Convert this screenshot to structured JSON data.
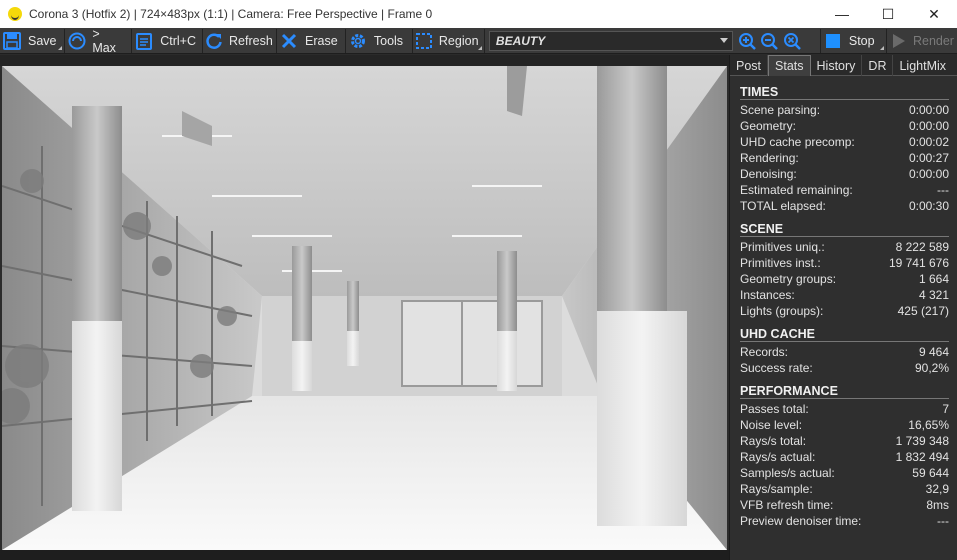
{
  "window": {
    "title": "Corona 3 (Hotfix 2) | 724×483px (1:1) | Camera: Free Perspective | Frame 0",
    "controls": {
      "minimize": "—",
      "maximize": "☐",
      "close": "✕"
    }
  },
  "toolbar": {
    "save": "Save",
    "max": "> Max",
    "copy": "Ctrl+C",
    "refresh": "Refresh",
    "erase": "Erase",
    "tools": "Tools",
    "region": "Region",
    "render_pass": "BEAUTY",
    "stop": "Stop",
    "render": "Render",
    "accent_color": "#1e90ff"
  },
  "tabs": [
    "Post",
    "Stats",
    "History",
    "DR",
    "LightMix"
  ],
  "active_tab": "Stats",
  "stats": {
    "times": {
      "title": "TIMES",
      "rows": [
        {
          "label": "Scene parsing:",
          "value": "0:00:00"
        },
        {
          "label": "Geometry:",
          "value": "0:00:00"
        },
        {
          "label": "UHD cache precomp:",
          "value": "0:00:02"
        },
        {
          "label": "Rendering:",
          "value": "0:00:27"
        },
        {
          "label": "Denoising:",
          "value": "0:00:00"
        },
        {
          "label": "Estimated remaining:",
          "value": "---"
        },
        {
          "label": "TOTAL elapsed:",
          "value": "0:00:30"
        }
      ]
    },
    "scene": {
      "title": "SCENE",
      "rows": [
        {
          "label": "Primitives uniq.:",
          "value": "8 222 589"
        },
        {
          "label": "Primitives inst.:",
          "value": "19 741 676"
        },
        {
          "label": "Geometry groups:",
          "value": "1 664"
        },
        {
          "label": "Instances:",
          "value": "4 321"
        },
        {
          "label": "Lights (groups):",
          "value": "425 (217)"
        }
      ]
    },
    "uhd": {
      "title": "UHD CACHE",
      "rows": [
        {
          "label": "Records:",
          "value": "9 464"
        },
        {
          "label": "Success rate:",
          "value": "90,2%"
        }
      ]
    },
    "performance": {
      "title": "PERFORMANCE",
      "rows": [
        {
          "label": "Passes total:",
          "value": "7"
        },
        {
          "label": "Noise level:",
          "value": "16,65%"
        },
        {
          "label": "Rays/s total:",
          "value": "1 739 348"
        },
        {
          "label": "Rays/s actual:",
          "value": "1 832 494"
        },
        {
          "label": "Samples/s actual:",
          "value": "59 644"
        },
        {
          "label": "Rays/sample:",
          "value": "32,9"
        },
        {
          "label": "VFB refresh time:",
          "value": "8ms"
        },
        {
          "label": "Preview denoiser time:",
          "value": "---"
        }
      ]
    }
  }
}
